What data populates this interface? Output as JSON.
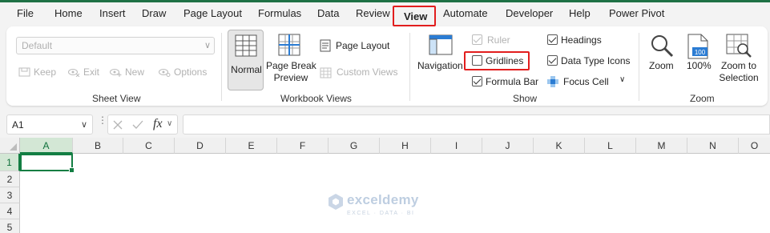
{
  "colors": {
    "accent": "#1e7145",
    "highlight": "#e21e1e",
    "selected_header": "#d3e7d5"
  },
  "tabs": [
    "File",
    "Home",
    "Insert",
    "Draw",
    "Page Layout",
    "Formulas",
    "Data",
    "Review",
    "View",
    "Automate",
    "Developer",
    "Help",
    "Power Pivot"
  ],
  "active_tab": "View",
  "ribbon": {
    "sheet_view": {
      "dropdown_value": "Default",
      "keep": "Keep",
      "exit": "Exit",
      "new": "New",
      "options": "Options",
      "label": "Sheet View"
    },
    "workbook_views": {
      "normal": "Normal",
      "page_break_line1": "Page Break",
      "page_break_line2": "Preview",
      "page_layout": "Page Layout",
      "custom_views": "Custom Views",
      "label": "Workbook Views"
    },
    "show": {
      "navigation": "Navigation",
      "ruler": "Ruler",
      "ruler_checked": true,
      "gridlines": "Gridlines",
      "gridlines_checked": false,
      "formula_bar": "Formula Bar",
      "formula_bar_checked": true,
      "headings": "Headings",
      "headings_checked": true,
      "data_type_icons": "Data Type Icons",
      "data_type_icons_checked": true,
      "focus_cell": "Focus Cell",
      "label": "Show"
    },
    "zoom": {
      "zoom": "Zoom",
      "zoom100": "100%",
      "zoom100_icon_text": "100",
      "zoom_sel_line1": "Zoom to",
      "zoom_sel_line2": "Selection",
      "label": "Zoom"
    }
  },
  "formula_bar": {
    "name_box": "A1",
    "fx": "fx",
    "value": ""
  },
  "sheet": {
    "columns": [
      "A",
      "B",
      "C",
      "D",
      "E",
      "F",
      "G",
      "H",
      "I",
      "J",
      "K",
      "L",
      "M",
      "N",
      "O"
    ],
    "rows": [
      "1",
      "2",
      "3",
      "4",
      "5"
    ],
    "selected_cell": "A1"
  },
  "watermark": {
    "brand": "exceldemy",
    "tagline": "EXCEL · DATA · BI"
  }
}
